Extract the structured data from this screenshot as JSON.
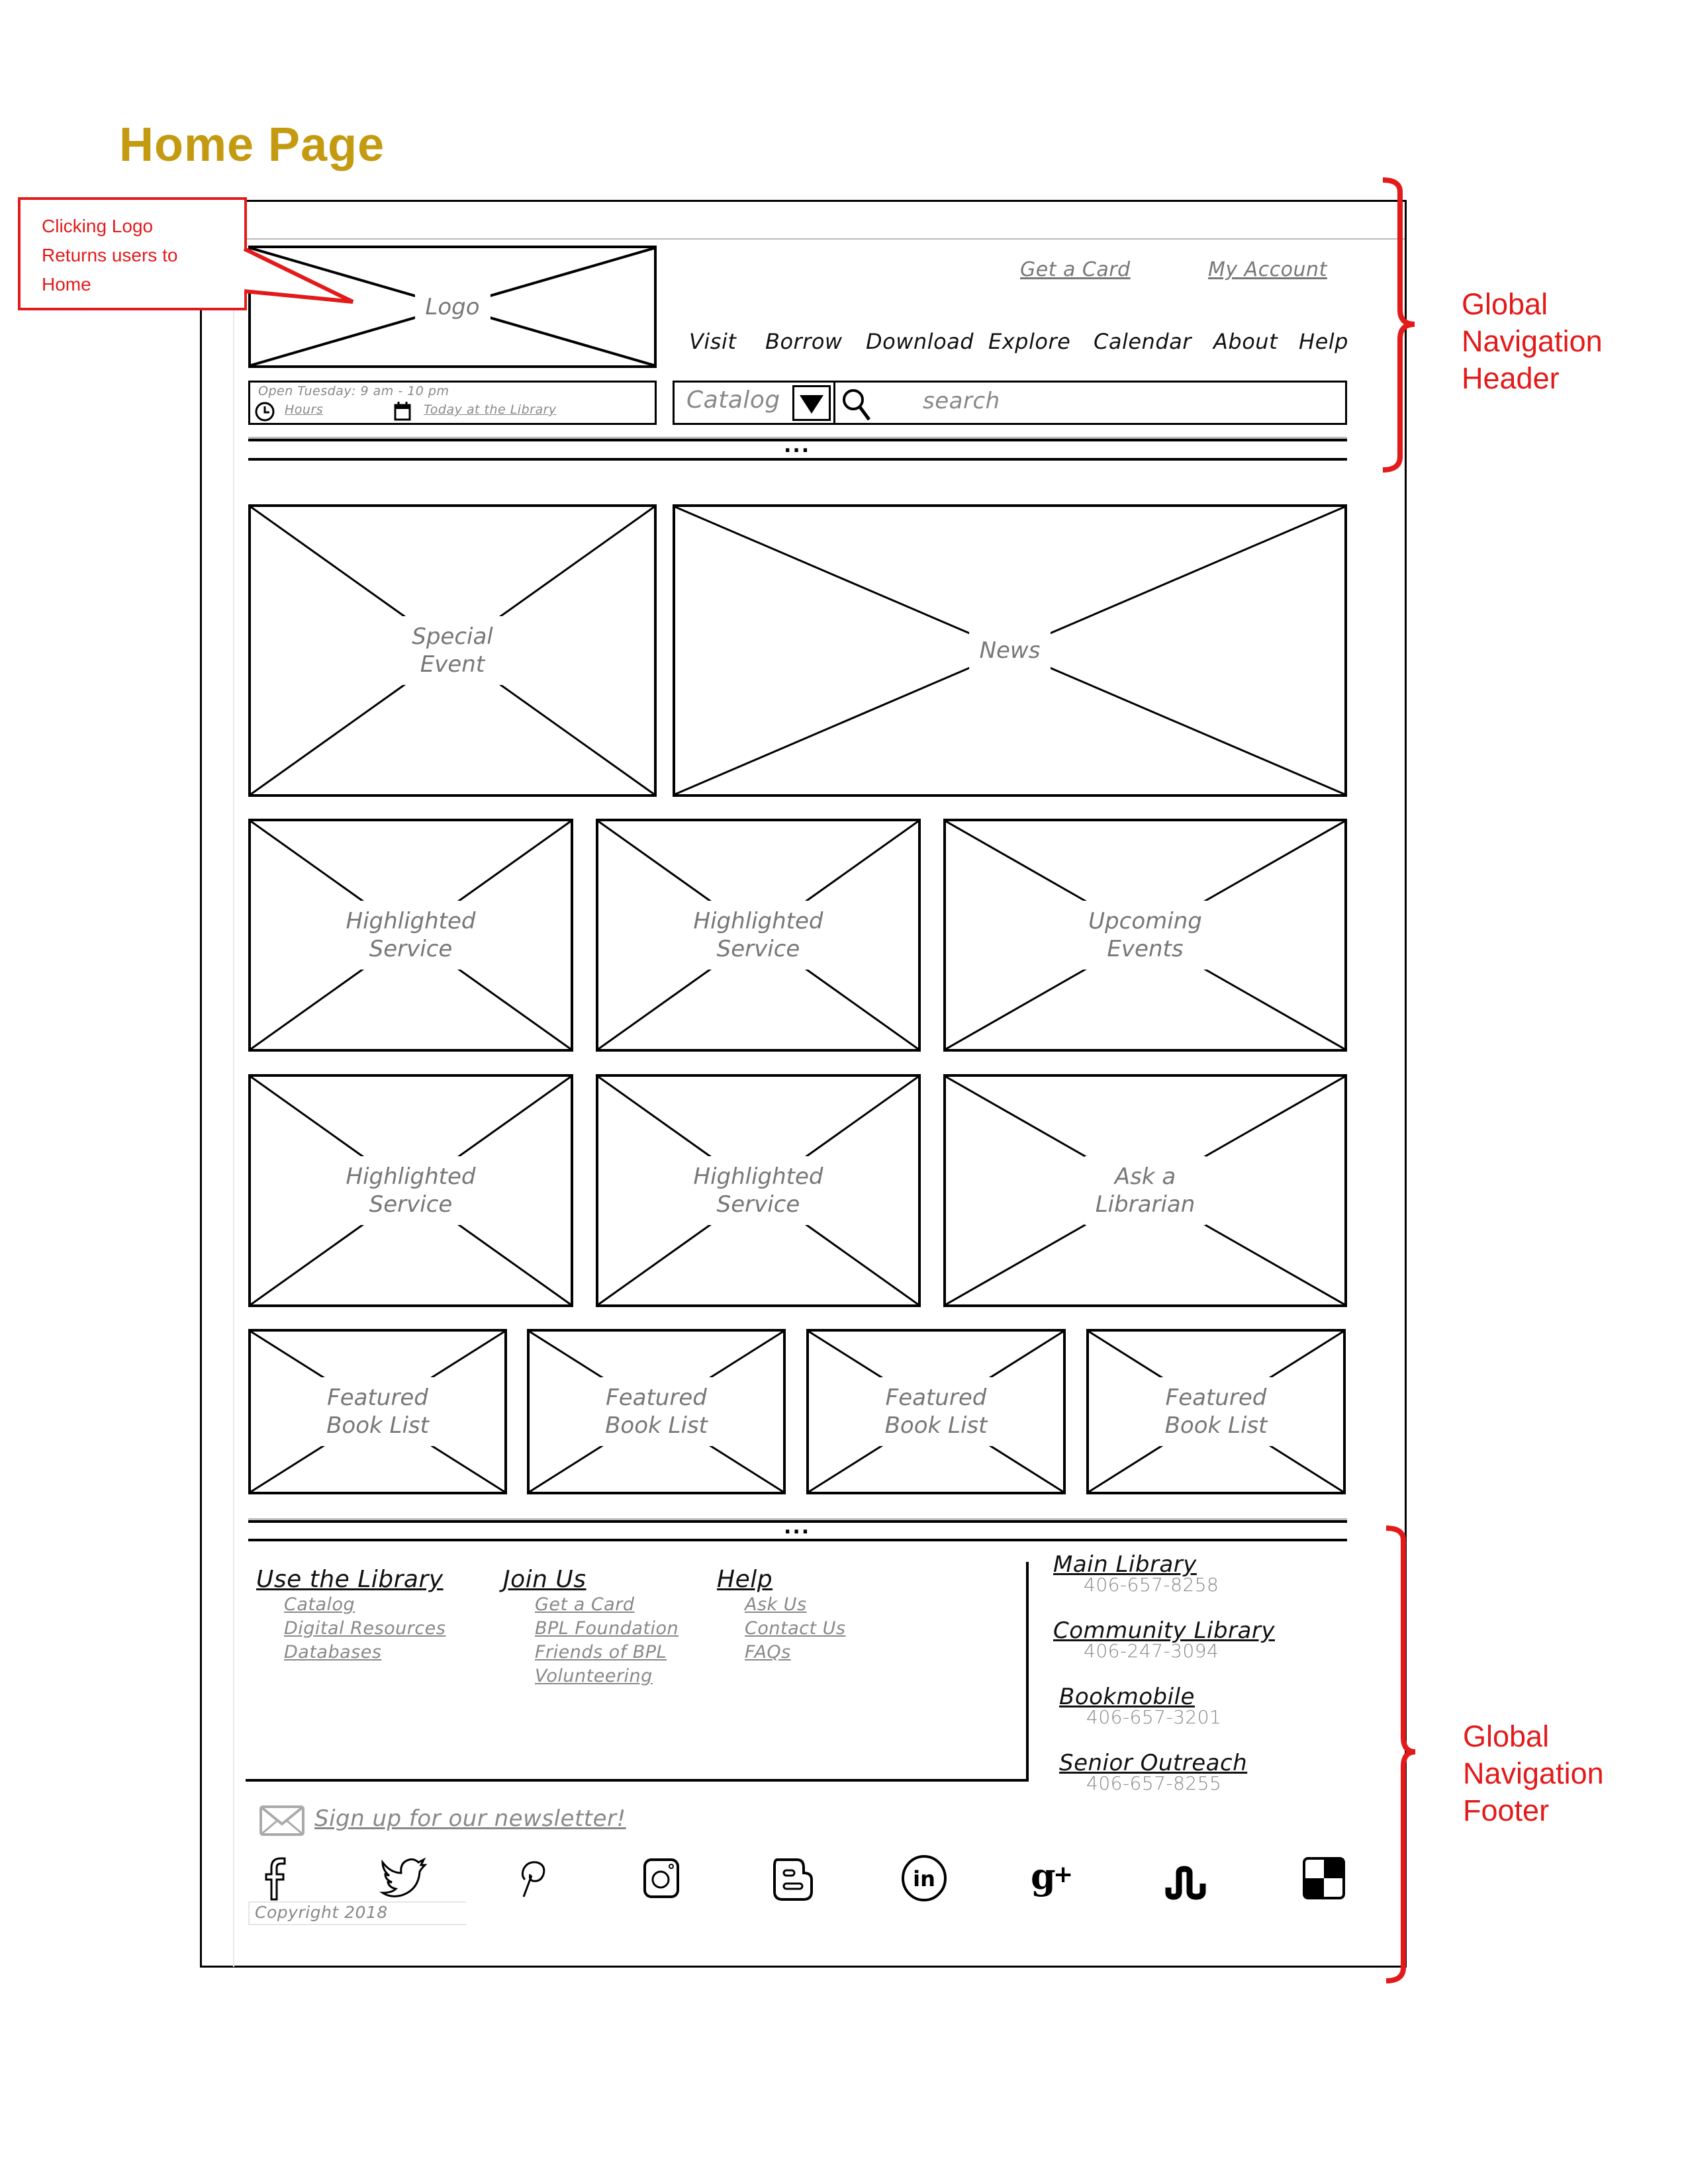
{
  "page_title": "Home Page",
  "callout": {
    "lines": [
      "Clicking Logo",
      "Returns users to",
      "Home"
    ]
  },
  "annotations": {
    "header": {
      "lines": [
        "Global",
        "Navigation",
        "Header"
      ]
    },
    "footer": {
      "lines": [
        "Global",
        "Navigation",
        "Footer"
      ]
    },
    "color": "#e31a1a"
  },
  "header": {
    "logo_label": "Logo",
    "top_links": [
      "Get a Card",
      "My Account"
    ],
    "nav": [
      "Visit",
      "Borrow",
      "Download",
      "Explore",
      "Calendar",
      "About",
      "Help"
    ],
    "hours": {
      "open_text": "Open Tuesday: 9 am - 10 pm",
      "hours_link": "Hours",
      "today_link": "Today at the Library"
    },
    "search": {
      "scope": "Catalog",
      "placeholder": "search"
    },
    "divider_dots": "..."
  },
  "main": {
    "hero": [
      {
        "label": [
          "Special",
          "Event"
        ]
      },
      {
        "label": [
          "News"
        ]
      }
    ],
    "row2": [
      {
        "label": [
          "Highlighted",
          "Service"
        ]
      },
      {
        "label": [
          "Highlighted",
          "Service"
        ]
      },
      {
        "label": [
          "Upcoming",
          "Events"
        ]
      }
    ],
    "row3": [
      {
        "label": [
          "Highlighted",
          "Service"
        ]
      },
      {
        "label": [
          "Highlighted",
          "Service"
        ]
      },
      {
        "label": [
          "Ask a",
          "Librarian"
        ]
      }
    ],
    "row4": [
      {
        "label": [
          "Featured",
          "Book List"
        ]
      },
      {
        "label": [
          "Featured",
          "Book List"
        ]
      },
      {
        "label": [
          "Featured",
          "Book List"
        ]
      },
      {
        "label": [
          "Featured",
          "Book List"
        ]
      }
    ]
  },
  "footer": {
    "divider_dots": "...",
    "columns": [
      {
        "heading": "Use the Library",
        "links": [
          "Catalog",
          "Digital Resources",
          "Databases"
        ]
      },
      {
        "heading": "Join Us",
        "links": [
          "Get a Card",
          "BPL Foundation",
          "Friends of BPL",
          "Volunteering"
        ]
      },
      {
        "heading": "Help",
        "links": [
          "Ask Us",
          "Contact Us",
          "FAQs"
        ]
      }
    ],
    "locations": [
      {
        "name": "Main Library",
        "phone": "406-657-8258"
      },
      {
        "name": "Community Library",
        "phone": "406-247-3094"
      },
      {
        "name": "Bookmobile",
        "phone": "406-657-3201"
      },
      {
        "name": "Senior Outreach",
        "phone": "406-657-8255"
      }
    ],
    "newsletter": "Sign up for our newsletter!",
    "social_icons": [
      "facebook-icon",
      "twitter-icon",
      "pinterest-icon",
      "instagram-icon",
      "blogger-icon",
      "linkedin-icon",
      "google-plus-icon",
      "stumbleupon-icon",
      "delicious-icon"
    ],
    "copyright": "Copyright 2018"
  },
  "colors": {
    "title": "#C49A10",
    "annotation": "#e31a1a",
    "wire": "#000000",
    "muted_text": "#888888"
  }
}
